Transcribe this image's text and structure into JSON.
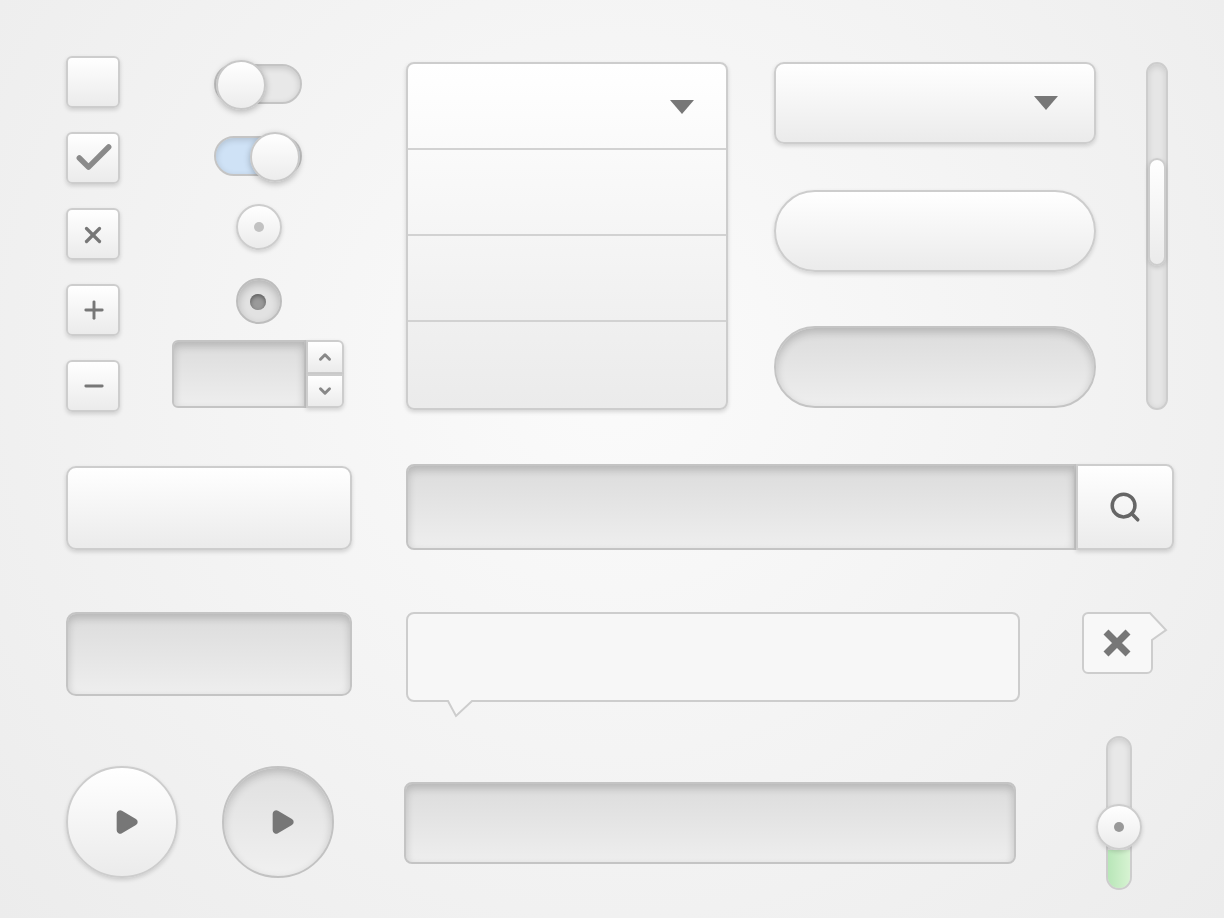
{
  "checkboxes": [
    {
      "checked": false
    },
    {
      "checked": true
    }
  ],
  "toggles": [
    {
      "on": false
    },
    {
      "on": true
    }
  ],
  "radios": [
    {
      "selected": false
    },
    {
      "selected": true
    }
  ],
  "pill_buttons": [
    {
      "pressed": false
    },
    {
      "pressed": true
    }
  ],
  "wide_buttons": [
    {
      "pressed": false
    },
    {
      "pressed": true
    }
  ],
  "play_buttons": [
    {
      "pressed": false
    },
    {
      "pressed": true
    }
  ],
  "vertical_slider": {
    "level": 0.25
  }
}
